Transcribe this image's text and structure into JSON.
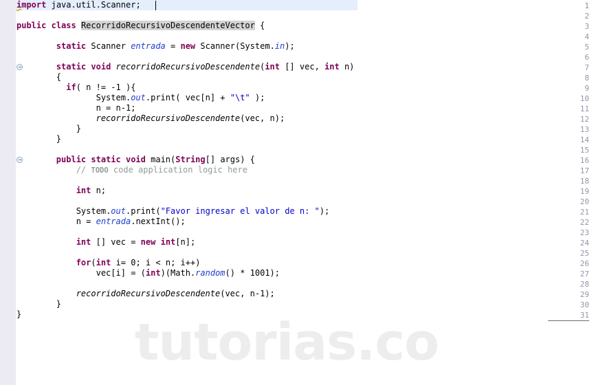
{
  "editor": {
    "language": "java",
    "watermark": "tutorias.co",
    "current_line": 1,
    "total_lines": 31,
    "caret": {
      "line": 1,
      "column": 29
    },
    "colors": {
      "background": "#ffffff",
      "gutter_background": "#eceaf2",
      "gutter_text": "#9a93a8",
      "current_line_highlight": "#e5eefc",
      "keyword": "#7f0055",
      "string": "#0000cc",
      "comment": "#8d9d97",
      "static_member": "#1f3fd0",
      "occurrence_highlight": "#d4d4d4",
      "watermark": "#ededed"
    },
    "fold_markers": [
      7,
      16
    ],
    "line_numbers": [
      "1",
      "2",
      "3",
      "4",
      "5",
      "6",
      "7",
      "8",
      "9",
      "10",
      "11",
      "12",
      "13",
      "14",
      "15",
      "16",
      "17",
      "18",
      "19",
      "20",
      "21",
      "22",
      "23",
      "24",
      "25",
      "26",
      "27",
      "28",
      "29",
      "30",
      "31"
    ],
    "code_lines": [
      {
        "n": 1,
        "text": "import java.util.Scanner;"
      },
      {
        "n": 2,
        "text": ""
      },
      {
        "n": 3,
        "text": "public class RecorridoRecursivoDescendenteVector {"
      },
      {
        "n": 4,
        "text": ""
      },
      {
        "n": 5,
        "text": "        static Scanner entrada = new Scanner(System.in);"
      },
      {
        "n": 6,
        "text": ""
      },
      {
        "n": 7,
        "text": "        static void recorridoRecursivoDescendente(int [] vec, int n)"
      },
      {
        "n": 8,
        "text": "        {"
      },
      {
        "n": 9,
        "text": "          if( n != -1 ){"
      },
      {
        "n": 10,
        "text": "                System.out.print( vec[n] + \"\\t\" );"
      },
      {
        "n": 11,
        "text": "                n = n-1;"
      },
      {
        "n": 12,
        "text": "                recorridoRecursivoDescendente(vec, n);"
      },
      {
        "n": 13,
        "text": "            }"
      },
      {
        "n": 14,
        "text": "        }"
      },
      {
        "n": 15,
        "text": ""
      },
      {
        "n": 16,
        "text": "        public static void main(String[] args) {"
      },
      {
        "n": 17,
        "text": "            // TODO code application logic here"
      },
      {
        "n": 18,
        "text": ""
      },
      {
        "n": 19,
        "text": "            int n;"
      },
      {
        "n": 20,
        "text": ""
      },
      {
        "n": 21,
        "text": "            System.out.print(\"Favor ingresar el valor de n: \");"
      },
      {
        "n": 22,
        "text": "            n = entrada.nextInt();"
      },
      {
        "n": 23,
        "text": ""
      },
      {
        "n": 24,
        "text": "            int [] vec = new int[n];"
      },
      {
        "n": 25,
        "text": ""
      },
      {
        "n": 26,
        "text": "            for(int i= 0; i < n; i++)"
      },
      {
        "n": 27,
        "text": "                vec[i] = (int)(Math.random() * 1001);"
      },
      {
        "n": 28,
        "text": ""
      },
      {
        "n": 29,
        "text": "            recorridoRecursivoDescendente(vec, n-1);"
      },
      {
        "n": 30,
        "text": "        }"
      },
      {
        "n": 31,
        "text": "}"
      }
    ]
  }
}
